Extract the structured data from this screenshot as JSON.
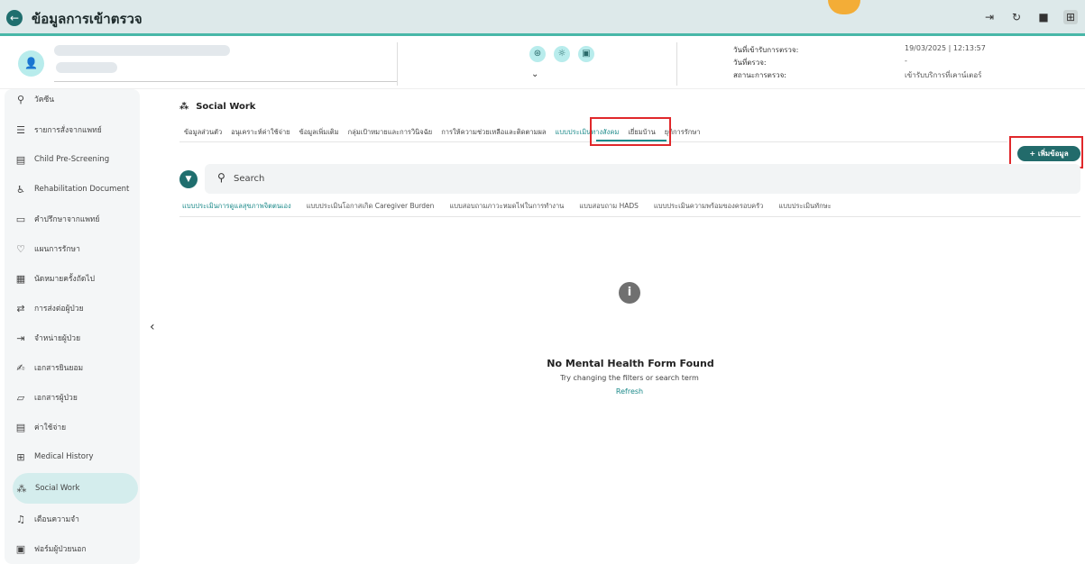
{
  "app": {
    "title": "ข้อมูลการเข้าตรวจ",
    "back_icon": "arrow-left-icon"
  },
  "toolbar": {
    "icons": [
      "logout-icon",
      "refresh-icon",
      "trash-icon",
      "add-panel-icon"
    ]
  },
  "patient": {
    "avatar_icon": "user-icon",
    "header_icons": [
      "wellness-icon",
      "sun-icon",
      "bookmark-icon"
    ],
    "expand_icon": "chevron-double-down-icon",
    "visit_info": [
      {
        "label": "วันที่เข้ารับการตรวจ:",
        "value": "19/03/2025 | 12:13:57"
      },
      {
        "label": "วันที่ตรวจ:",
        "value": "-"
      },
      {
        "label": "สถานะการตรวจ:",
        "value": "เข้ารับบริการที่เคาน์เตอร์"
      }
    ]
  },
  "sidebar": {
    "items": [
      {
        "label": "วัคซีน",
        "icon": "vaccine-icon"
      },
      {
        "label": "รายการสั่งจากแพทย์",
        "icon": "list-icon"
      },
      {
        "label": "Child Pre-Screening",
        "icon": "screening-icon"
      },
      {
        "label": "Rehabilitation Document",
        "icon": "rehab-icon"
      },
      {
        "label": "คำปรึกษาจากแพทย์",
        "icon": "consult-icon"
      },
      {
        "label": "แผนการรักษา",
        "icon": "treatment-plan-icon"
      },
      {
        "label": "นัดหมายครั้งถัดไป",
        "icon": "calendar-icon"
      },
      {
        "label": "การส่งต่อผู้ป่วย",
        "icon": "transfer-icon"
      },
      {
        "label": "จำหน่ายผู้ป่วย",
        "icon": "discharge-icon"
      },
      {
        "label": "เอกสารยินยอม",
        "icon": "consent-icon"
      },
      {
        "label": "เอกสารผู้ป่วย",
        "icon": "folder-icon"
      },
      {
        "label": "ค่าใช้จ่าย",
        "icon": "receipt-icon"
      },
      {
        "label": "Medical History",
        "icon": "medical-history-icon"
      },
      {
        "label": "Social Work",
        "icon": "people-icon",
        "active": true
      },
      {
        "label": "เตือนความจำ",
        "icon": "bell-icon"
      },
      {
        "label": "ฟอร์มผู้ป่วยนอก",
        "icon": "form-icon"
      }
    ],
    "collapse_icon": "chevron-left-icon"
  },
  "section": {
    "title": "Social Work",
    "icon": "people-icon"
  },
  "main_tabs": [
    {
      "label": "ข้อมูลส่วนตัว"
    },
    {
      "label": "อนุเคราะห์ค่าใช้จ่าย"
    },
    {
      "label": "ข้อมูลเพิ่มเติม"
    },
    {
      "label": "กลุ่มเป้าหมายและการวินิจฉัย"
    },
    {
      "label": "การให้ความช่วยเหลือและติดตามผล"
    },
    {
      "label": "แบบประเมินทางสังคม",
      "active": true
    },
    {
      "label": "เยี่ยมบ้าน"
    },
    {
      "label": "ยุติการรักษา"
    }
  ],
  "add_button": {
    "label": "+ เพิ่มข้อมูล"
  },
  "search": {
    "placeholder": "Search",
    "filter_icon": "filter-icon",
    "search_icon": "search-icon"
  },
  "sub_tabs": [
    {
      "label": "แบบประเมินการดูแลสุขภาพจิตตนเอง",
      "active": true
    },
    {
      "label": "แบบประเมินโอกาสเกิด Caregiver Burden"
    },
    {
      "label": "แบบสอบถามภาวะหมดไฟในการทำงาน"
    },
    {
      "label": "แบบสอบถาม HADS"
    },
    {
      "label": "แบบประเมินความพร้อมของครอบครัว"
    },
    {
      "label": "แบบประเมินทักษะ"
    }
  ],
  "empty_state": {
    "icon": "info-icon",
    "title": "No Mental Health Form Found",
    "subtitle": "Try changing the filters or search term",
    "refresh_label": "Refresh"
  },
  "colors": {
    "accent": "#1c8a8a",
    "primary_dark": "#1f6e6e",
    "highlight": "#e0282b",
    "topbar_bg": "#dde9ea"
  }
}
